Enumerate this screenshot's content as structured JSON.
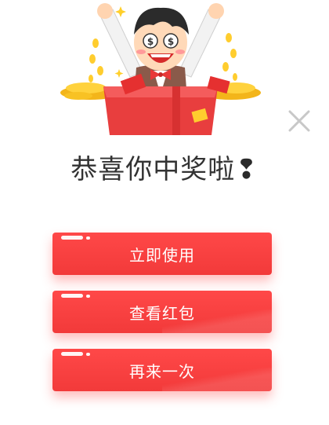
{
  "dialog": {
    "title": "恭喜你中奖啦",
    "title_mark": "❢",
    "close_icon": "close-icon",
    "illustration": "winner-with-red-packets",
    "buttons": [
      {
        "label": "立即使用"
      },
      {
        "label": "查看红包"
      },
      {
        "label": "再来一次"
      }
    ]
  },
  "colors": {
    "button_red": "#ff4444",
    "title_text": "#333333",
    "close_gray": "#c8c8c8",
    "gold": "#f5c518",
    "box_red": "#e83e3e"
  }
}
